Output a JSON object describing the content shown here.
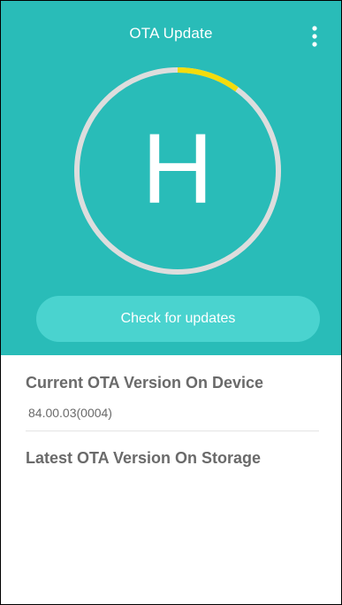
{
  "app": {
    "title": "OTA Update",
    "menu_icon": "more-vert-icon"
  },
  "progress": {
    "fraction": 0.1,
    "track_color": "#dddddd",
    "fill_color": "#f3dc0c"
  },
  "brand": {
    "letter": "H"
  },
  "actions": {
    "check_label": "Check for updates"
  },
  "current": {
    "heading": "Current OTA Version On Device",
    "value": "84.00.03(0004)"
  },
  "latest": {
    "heading": "Latest OTA Version On Storage"
  },
  "colors": {
    "accent": "#29bcb8",
    "button": "#4ad3cf",
    "text_gray": "#6a6a6a"
  }
}
